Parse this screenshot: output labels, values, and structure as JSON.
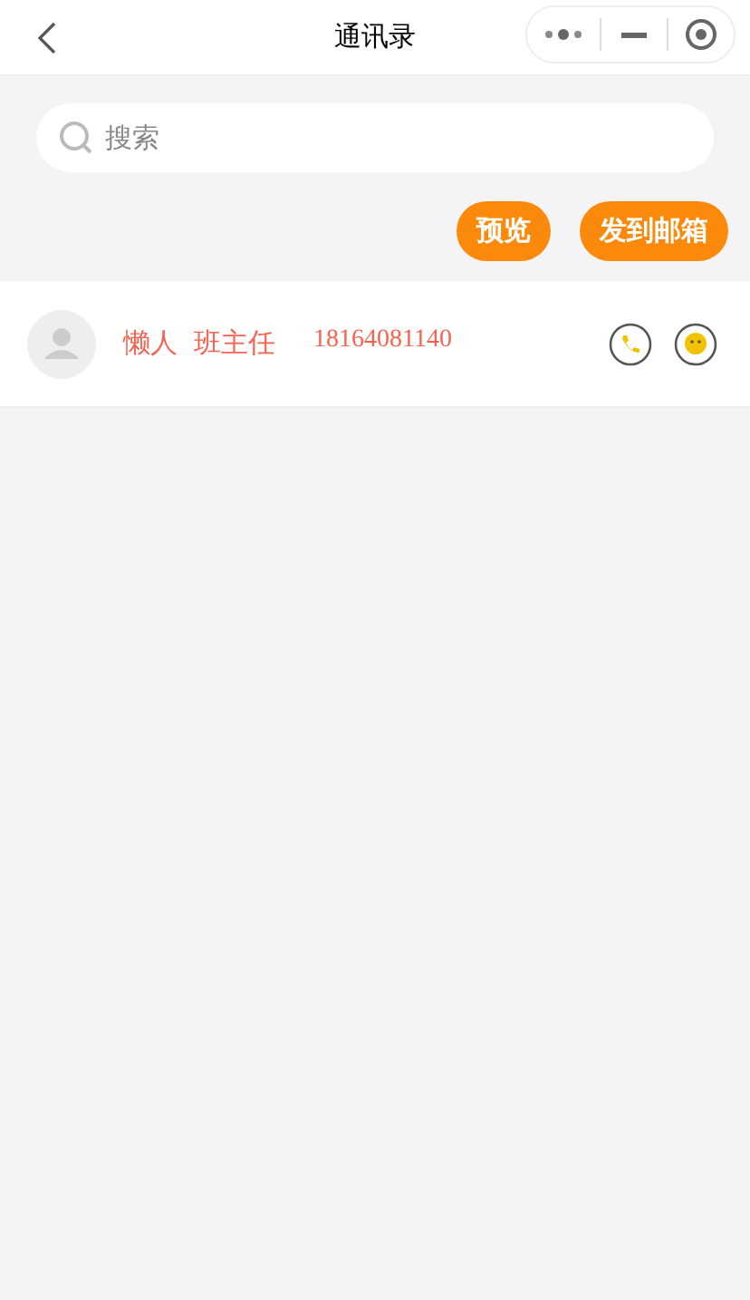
{
  "window": {
    "title": "通讯录"
  },
  "search": {
    "placeholder": "搜索"
  },
  "actions": [
    "预览",
    "发到邮箱"
  ],
  "contacts": [
    {
      "name": "懒人",
      "role": "班主任",
      "phone": "18164081140"
    }
  ]
}
